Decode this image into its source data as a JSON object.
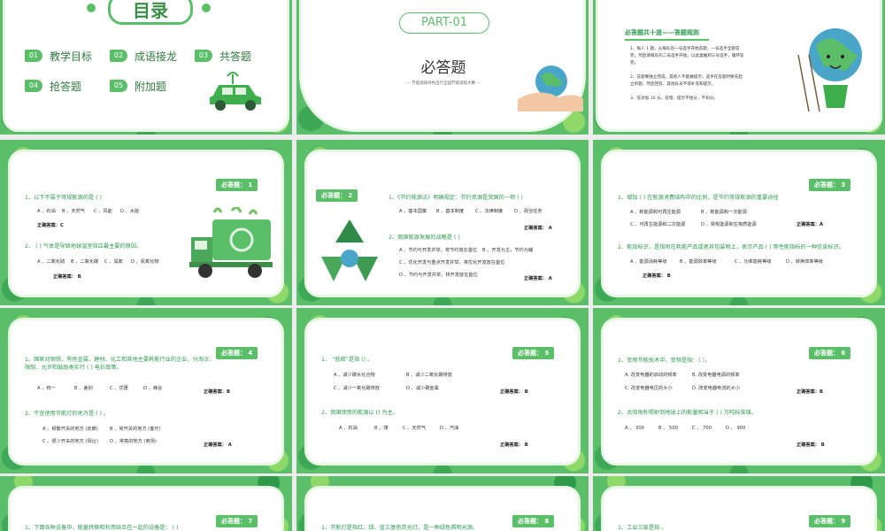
{
  "toc": {
    "title": "目录",
    "items": [
      {
        "num": "01",
        "label": "教学目标"
      },
      {
        "num": "02",
        "label": "成语接龙"
      },
      {
        "num": "03",
        "label": "共答题"
      },
      {
        "num": "04",
        "label": "抢答题"
      },
      {
        "num": "05",
        "label": "附加题"
      }
    ]
  },
  "part": {
    "badge": "PART-01",
    "title": "必答题",
    "subtitle": "— 节能减排绿色出行全国节能减排大赛 —"
  },
  "rules": {
    "title": "必答题共十道——答题规则",
    "items": [
      "1、每人 1 题，从每队的一号选手开始答题，一号选手全部答完，然后请每队的二号选手开始，以此类推到三号选手，循环答完。",
      "2、答题要独立完成，其他人不能做提示，选手在答题时要先起立听题，然后回答，其他队员不得补充和提示。",
      "3、答对加 10 分，答错、提示不给分，不扣分。"
    ]
  },
  "slides": [
    {
      "tag": "必答题： 1",
      "questions": [
        {
          "q": "1、以下不属于常规能源的是 ( )",
          "options": [
            "A 、石油",
            "B 、天然气",
            "C 、风能",
            "D 、水能"
          ],
          "answer": "正确答案：C"
        },
        {
          "q": "2、 ( ) 气体是导致地球温室效应最主要的原因。",
          "options": [
            "A 、二氧化硫",
            "B 、二氧化碳",
            "C 、臭氧",
            "D 、氮氧化物"
          ],
          "answer": "正确答案： B"
        }
      ]
    },
    {
      "tag": "必答题： 2",
      "questions": [
        {
          "q": "1、《节约能源法》明确规定：节约资源是我国的一项 ( )",
          "options": [
            "A 、基本国策",
            "B 、基本制度",
            "C 、法律制度",
            "D 、政治任务"
          ],
          "answer": "正确答案：  A"
        },
        {
          "q": "2、我国能源发展的战略是 ( )",
          "options": [
            "A 、节约与开发并举，将节约放在首位",
            "B 、开发为主，节约为辅",
            "C 、优化开发与重点开发并举，将优化开发放在首位",
            "D 、节约与开发并举，将开发放在首位"
          ],
          "answer": "正确答案：  A"
        }
      ]
    },
    {
      "tag": "必答题： 3",
      "questions": [
        {
          "q": "1、增加 ( ) 在能源消费结构中的比例，是节约常规能源的重要途径",
          "options": [
            "A 、新能源和可再生能源",
            "B 、新能源和一次能源",
            "C 、可再生能源和二次能源",
            "D 、常规能源和生物质能源"
          ],
          "answer": "正确答案：A"
        },
        {
          "q": "2、能效标识，是指附在耗能产品或者其包装物上，表示产品 ( ) 等性能指标的一种信息标识。",
          "options": [
            "A 、能源消耗等级",
            "B 、能源效率等级",
            "C 、功率能耗等级",
            "D 、转换效率等级"
          ],
          "answer": "正确答案：  B"
        }
      ]
    },
    {
      "tag": "必答题： 4",
      "questions": [
        {
          "q": "1、国家对钢铁、有色金属、建材、化工和其他主要耗能行业的企业，分淘汰、限制、允许和鼓励类实行 ( ) 电价政策。",
          "options": [
            "A 、统一",
            "B 、差别",
            "C 、优惠",
            "D 、峰谷"
          ],
          "answer": "正确答案：B"
        },
        {
          "q": "2、不宜使用节能灯的地方是 ( ) 。",
          "options": [
            "A 、频繁开关的地方 (走廊)",
            "B 、常开关的地方 (客厅)",
            "C 、很少开关的地方 (阳台)",
            "D 、常亮的地方 (商场)"
          ],
          "answer": "正确答案：  A"
        }
      ]
    },
    {
      "tag": "必答题： 5",
      "questions": [
        {
          "q": "1、 “低碳”是指 () 。",
          "options": [
            "A 、减少碳水化合物",
            "B 、减少二氧化碳排放",
            "C 、减少一氧化碳排放",
            "D 、减少碳金属"
          ],
          "answer": "正确答案： B"
        },
        {
          "q": "2、我国使用的能源以 () 为主。",
          "options": [
            "A 、石油",
            "B 、煤",
            "C 、天然气",
            "D 、汽油"
          ],
          "answer": "正确答案： B"
        }
      ]
    },
    {
      "tag": "必答题： 6",
      "questions": [
        {
          "q": "1、变频节能技术中，变频是指：（ ）。",
          "options": [
            "A. 改变电器的启动的频率",
            "B. 改变电器电源的频率",
            "C. 改变电器电压的大小",
            "D. 改变电器电流的大小"
          ],
          "answer": "正确答案：B"
        },
        {
          "q": "2、太阳每秒照射到地球上的能量相当于 ( ) 万吨标准煤。",
          "options": [
            "A 、 300",
            "B 、 500",
            "C 、 700",
            "D 、 900"
          ],
          "answer": "正确答案：  B"
        }
      ]
    },
    {
      "tag": "必答题： 7",
      "questions": [
        {
          "q": "1、下面各种设备中，能量转换和利用结合在一起的设备是： ( )",
          "options": [],
          "answer": ""
        }
      ]
    },
    {
      "tag": "必答题： 8",
      "questions": [
        {
          "q": "1、节能灯是指红、绿、蓝三基色荧光灯，是一种绿色照明光源。",
          "options": [],
          "answer": ""
        }
      ]
    },
    {
      "tag": "必答题： 9",
      "questions": [
        {
          "q": "1、工业三废是指 。",
          "options": [],
          "answer": ""
        }
      ]
    }
  ]
}
